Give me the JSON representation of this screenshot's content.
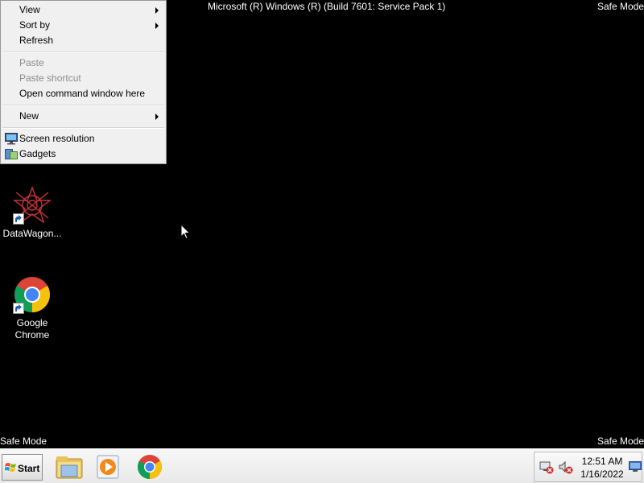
{
  "banner": {
    "title": "Microsoft (R) Windows (R) (Build 7601: Service Pack 1)",
    "corner_label": "Safe Mode"
  },
  "context_menu": {
    "items": [
      {
        "label": "View",
        "submenu": true,
        "enabled": true
      },
      {
        "label": "Sort by",
        "submenu": true,
        "enabled": true
      },
      {
        "label": "Refresh",
        "submenu": false,
        "enabled": true
      },
      {
        "label": "Paste",
        "submenu": false,
        "enabled": false
      },
      {
        "label": "Paste shortcut",
        "submenu": false,
        "enabled": false
      },
      {
        "label": "Open command window here",
        "submenu": false,
        "enabled": true
      },
      {
        "label": "New",
        "submenu": true,
        "enabled": true
      },
      {
        "label": "Screen resolution",
        "submenu": false,
        "enabled": true,
        "icon": "monitor-icon"
      },
      {
        "label": "Gadgets",
        "submenu": false,
        "enabled": true,
        "icon": "gadgets-icon"
      }
    ]
  },
  "desktop_icons": [
    {
      "label": "DataWagon...",
      "icon": "datawagon-icon"
    },
    {
      "label": "Google Chrome",
      "icon": "chrome-icon"
    }
  ],
  "taskbar": {
    "start_label": "Start",
    "pinned": [
      "explorer-icon",
      "media-player-icon",
      "chrome-icon"
    ],
    "tray_icons": [
      "network-error-icon",
      "volume-muted-icon",
      "show-desktop-icon"
    ],
    "time": "12:51 AM",
    "date": "1/16/2022"
  },
  "colors": {
    "desktop": "#000000",
    "menu_bg": "#f0f0f0",
    "disabled_text": "#8d8d8d"
  }
}
